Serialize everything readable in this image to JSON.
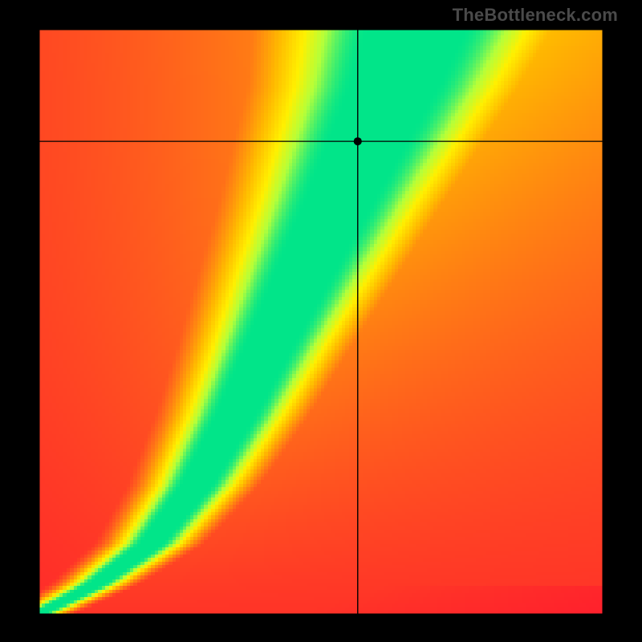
{
  "watermark": "TheBottleneck.com",
  "chart_data": {
    "type": "heatmap",
    "title": "",
    "xlabel": "",
    "ylabel": "",
    "xlim": [
      0,
      1
    ],
    "ylim": [
      0,
      1
    ],
    "grid": false,
    "legend": false,
    "crosshair": {
      "x": 0.565,
      "y": 0.808
    },
    "marker": {
      "x": 0.565,
      "y": 0.808
    },
    "colorscale": [
      {
        "t": 0.0,
        "color": "#ff1a2e"
      },
      {
        "t": 0.25,
        "color": "#ff6a1a"
      },
      {
        "t": 0.5,
        "color": "#ffb800"
      },
      {
        "t": 0.7,
        "color": "#fff000"
      },
      {
        "t": 0.85,
        "color": "#b4ff3a"
      },
      {
        "t": 1.0,
        "color": "#00e58a"
      }
    ],
    "ridge": [
      {
        "x": 0.0,
        "y": 0.0
      },
      {
        "x": 0.1,
        "y": 0.05
      },
      {
        "x": 0.2,
        "y": 0.12
      },
      {
        "x": 0.28,
        "y": 0.22
      },
      {
        "x": 0.35,
        "y": 0.34
      },
      {
        "x": 0.42,
        "y": 0.48
      },
      {
        "x": 0.5,
        "y": 0.64
      },
      {
        "x": 0.58,
        "y": 0.8
      },
      {
        "x": 0.63,
        "y": 0.9
      },
      {
        "x": 0.67,
        "y": 1.0
      }
    ],
    "ridge_width": [
      {
        "y": 0.0,
        "w": 0.01
      },
      {
        "y": 0.1,
        "w": 0.018
      },
      {
        "y": 0.25,
        "w": 0.028
      },
      {
        "y": 0.45,
        "w": 0.04
      },
      {
        "y": 0.7,
        "w": 0.058
      },
      {
        "y": 0.9,
        "w": 0.075
      },
      {
        "y": 1.0,
        "w": 0.085
      }
    ],
    "resolution": {
      "cols": 160,
      "rows": 166
    }
  }
}
